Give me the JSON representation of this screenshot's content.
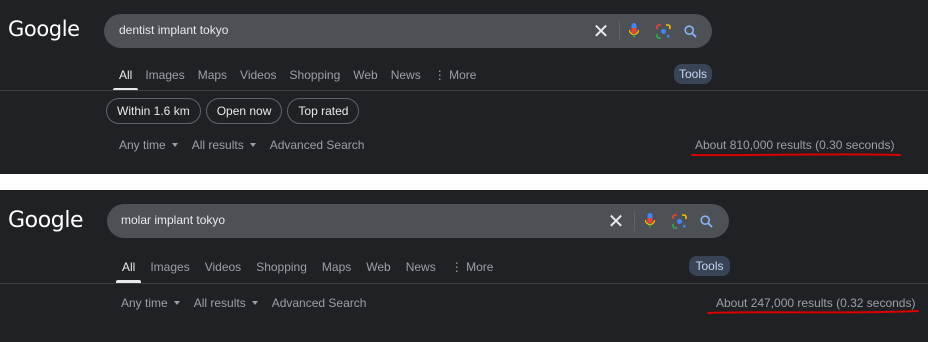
{
  "panels": [
    {
      "logo": "Google",
      "query": "dentist implant tokyo",
      "tabs": [
        "All",
        "Images",
        "Maps",
        "Videos",
        "Shopping",
        "Web",
        "News",
        "⋮ More"
      ],
      "tools_label": "Tools",
      "chips": [
        "Within 1.6 km",
        "Open now",
        "Top rated"
      ],
      "filters": [
        "Any time",
        "All results",
        "Advanced Search"
      ],
      "results": "About 810,000 results (0.30 seconds)"
    },
    {
      "logo": "Google",
      "query": "molar implant tokyo",
      "tabs": [
        "All",
        "Images",
        "Videos",
        "Shopping",
        "Maps",
        "Web",
        "News",
        "⋮ More"
      ],
      "tools_label": "Tools",
      "filters": [
        "Any time",
        "All results",
        "Advanced Search"
      ],
      "results": "About 247,000 results (0.32 seconds)"
    }
  ],
  "colors": {
    "background": "#202124",
    "searchbar": "#4d5156",
    "tools": "#394457",
    "annotation": "#d90000"
  },
  "icons": [
    "close-icon",
    "microphone-icon",
    "google-lens-icon",
    "search-icon"
  ]
}
